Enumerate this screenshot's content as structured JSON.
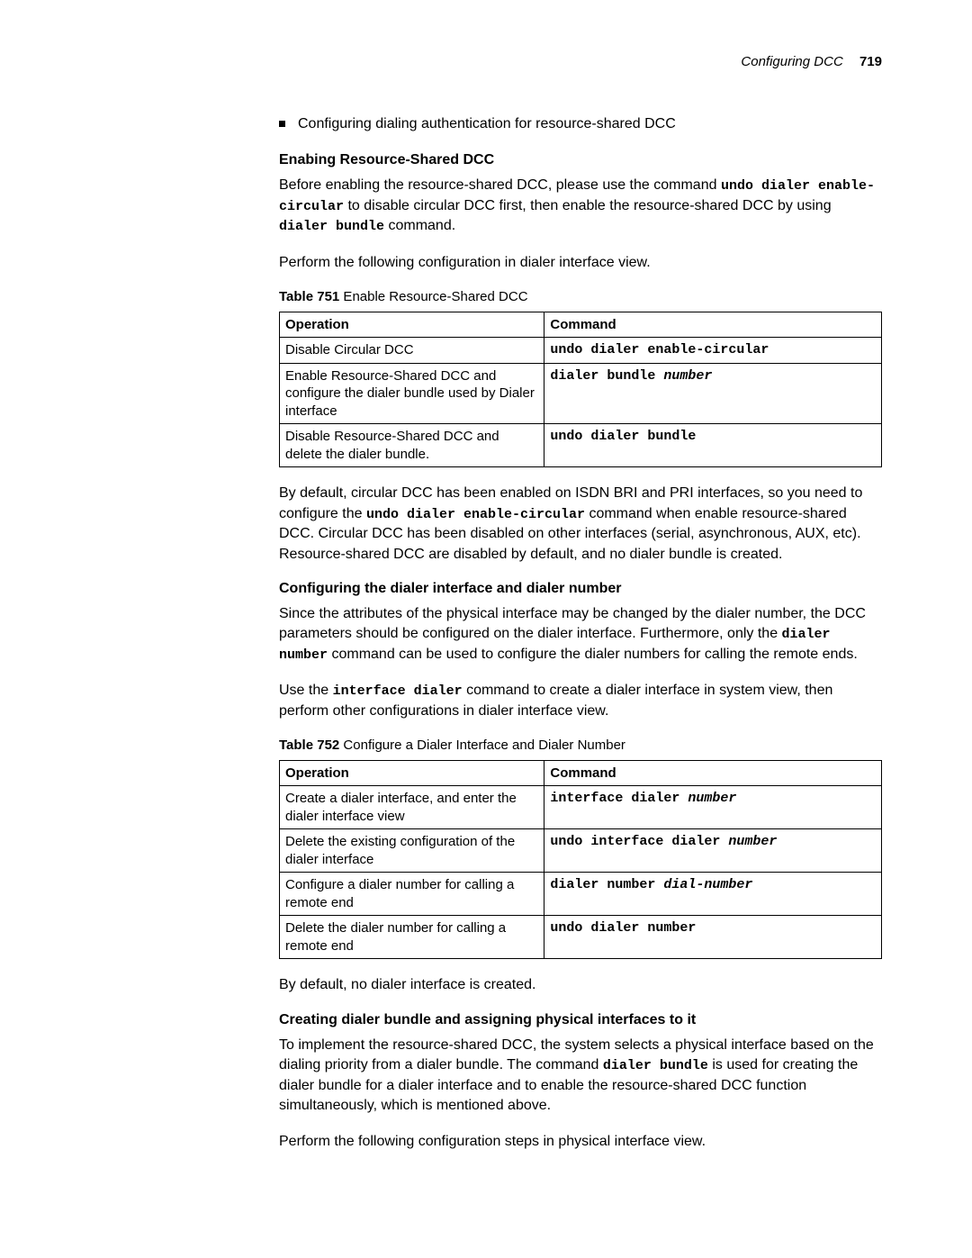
{
  "header": {
    "title": "Configuring DCC",
    "page": "719"
  },
  "bullet": {
    "text": "Configuring dialing authentication for resource-shared DCC"
  },
  "sec1": {
    "title": "Enabing Resource-Shared DCC",
    "p1_a": "Before enabling the resource-shared DCC, please use the command ",
    "p1_code1": "undo dialer enable-circular",
    "p1_b": " to disable circular DCC first, then enable the resource-shared DCC by using ",
    "p1_code2": "dialer bundle",
    "p1_c": " command.",
    "p2": "Perform the following configuration in dialer interface view.",
    "table_label": "Table 751",
    "table_caption": "   Enable Resource-Shared DCC",
    "th1": "Operation",
    "th2": "Command",
    "r1_op": "Disable Circular DCC",
    "r1_cmd": "undo dialer enable-circular",
    "r2_op": "Enable Resource-Shared DCC and configure the dialer bundle used by Dialer interface",
    "r2_cmd_a": "dialer bundle ",
    "r2_cmd_b": "number",
    "r3_op": "Disable Resource-Shared DCC and delete the dialer bundle.",
    "r3_cmd": "undo dialer bundle",
    "p3_a": "By default, circular DCC has been enabled on ISDN BRI and PRI interfaces, so you need to configure the ",
    "p3_code": "undo dialer enable-circular",
    "p3_b": " command when enable resource-shared DCC. Circular DCC has been disabled on other interfaces (serial, asynchronous, AUX, etc). Resource-shared DCC are disabled by default, and no dialer bundle is created."
  },
  "sec2": {
    "title": "Configuring the dialer interface and dialer number",
    "p1_a": "Since the attributes of the physical interface may be changed by the dialer number, the DCC parameters should be configured on the dialer interface. Furthermore, only the ",
    "p1_code": "dialer number",
    "p1_b": " command can be used to configure the dialer numbers for calling the remote ends.",
    "p2_a": "Use the ",
    "p2_code": "interface dialer",
    "p2_b": " command to create a dialer interface in system view, then perform other configurations in dialer interface view.",
    "table_label": "Table 752",
    "table_caption": "   Configure a Dialer Interface and Dialer Number",
    "th1": "Operation",
    "th2": "Command",
    "r1_op": "Create a dialer interface, and enter the dialer interface view",
    "r1_cmd_a": "interface dialer ",
    "r1_cmd_b": "number",
    "r2_op": "Delete the existing configuration of the dialer interface",
    "r2_cmd_a": "undo interface dialer ",
    "r2_cmd_b": "number",
    "r3_op": "Configure a dialer number for calling a remote end",
    "r3_cmd_a": "dialer number ",
    "r3_cmd_b": "dial-number",
    "r4_op": "Delete the dialer number for calling a remote end",
    "r4_cmd": "undo dialer number",
    "p3": "By default, no dialer interface is created."
  },
  "sec3": {
    "title": "Creating dialer bundle and assigning physical interfaces to it",
    "p1_a": "To implement the resource-shared DCC, the system selects a physical interface based on the dialing priority from a dialer bundle. The command ",
    "p1_code": "dialer bundle",
    "p1_b": " is used for creating the dialer bundle for a dialer interface and to enable the resource-shared DCC function simultaneously, which is mentioned above.",
    "p2": "Perform the following configuration steps in physical interface view."
  }
}
